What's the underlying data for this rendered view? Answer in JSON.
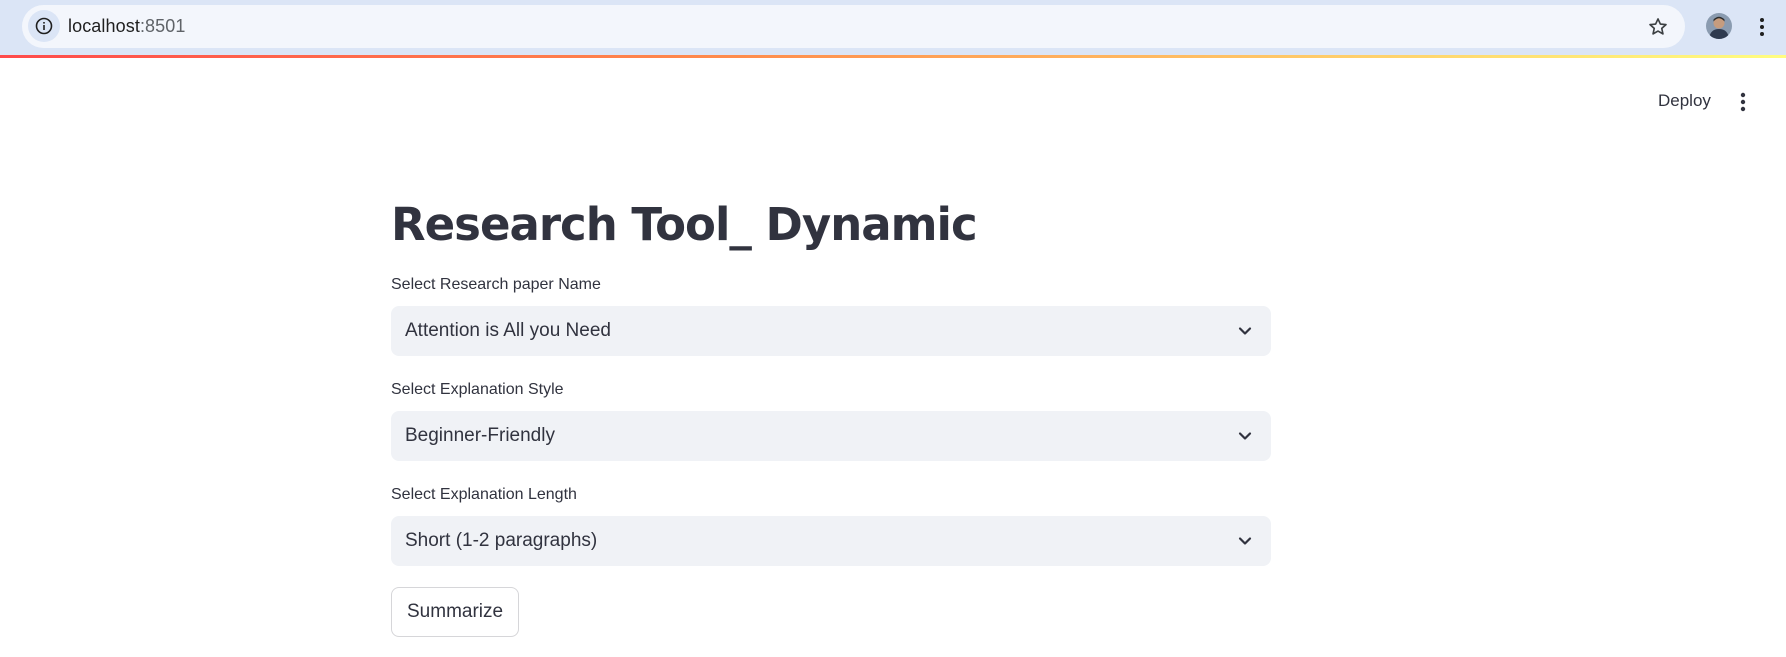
{
  "browser": {
    "url_host": "localhost",
    "url_port": ":8501"
  },
  "header": {
    "deploy_label": "Deploy"
  },
  "main": {
    "title": "Research Tool_ Dynamic",
    "fields": [
      {
        "label": "Select Research paper Name",
        "value": "Attention is All you Need"
      },
      {
        "label": "Select Explanation Style",
        "value": "Beginner-Friendly"
      },
      {
        "label": "Select Explanation Length",
        "value": "Short (1-2 paragraphs)"
      }
    ],
    "submit_label": "Summarize"
  },
  "icons": {
    "site_info": "info-icon",
    "bookmark": "star-icon",
    "profile": "avatar",
    "chrome_menu": "kebab-menu-icon",
    "app_menu": "kebab-menu-icon",
    "dropdown": "chevron-down-icon"
  },
  "colors": {
    "accent_gradient_start": "#ff4b4b",
    "accent_gradient_end": "#fffd80",
    "select_bg": "#f0f2f6",
    "text": "#31333f"
  }
}
